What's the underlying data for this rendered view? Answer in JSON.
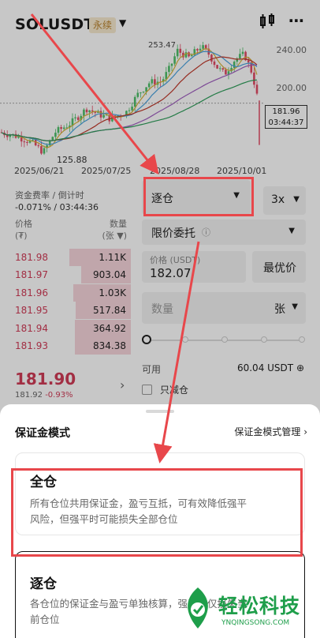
{
  "header": {
    "symbol": "SOLUSDT",
    "contract_tag": "永续",
    "caret_icon": "caret-down-icon",
    "chart_icon": "candlestick-icon",
    "more_icon": "more-icon"
  },
  "chart": {
    "y_ticks": [
      "240.00",
      "200.00"
    ],
    "x_ticks": [
      "2025/06/21",
      "2025/07/25",
      "2025/08/28",
      "2025/10/01"
    ],
    "low_label": "125.88",
    "high_label": "253.47",
    "current_price": "181.96",
    "countdown": "03:44:37",
    "colors": {
      "up": "#4fbf6a",
      "down": "#e24b64",
      "ma_red": "#c0392b",
      "ma_green": "#2e9e5a",
      "ma_purple": "#a05fc0",
      "ma_blue": "#4aa3df",
      "ma_yellow": "#d8b23a"
    }
  },
  "funding": {
    "label": "资金费率 / 倒计时",
    "value": "-0.071% / 03:44:36"
  },
  "orderbook": {
    "price_header": "价格",
    "price_unit": "(₮)",
    "qty_header": "数量",
    "qty_unit": "(张 ▼)",
    "asks": [
      {
        "price": "181.98",
        "qty": "1.11K",
        "depth": 0.47
      },
      {
        "price": "181.97",
        "qty": "903.04",
        "depth": 0.38
      },
      {
        "price": "181.96",
        "qty": "1.03K",
        "depth": 0.44
      },
      {
        "price": "181.95",
        "qty": "517.84",
        "depth": 0.42
      },
      {
        "price": "181.94",
        "qty": "364.92",
        "depth": 0.43
      },
      {
        "price": "181.93",
        "qty": "834.38",
        "depth": 0.43
      }
    ],
    "last_price": "181.90",
    "mark_price": "181.92",
    "change": "-0.93%"
  },
  "order_form": {
    "margin_mode": "逐仓",
    "leverage": "3x",
    "order_type": "限价委托",
    "price_label": "价格 (USDT)",
    "price_value": "182.07",
    "best_price_button": "最优价",
    "qty_placeholder": "数量",
    "qty_unit": "张",
    "slider_level": 0,
    "available_label": "可用",
    "available_value": "60.04 USDT",
    "reduce_only_label": "只减仓"
  },
  "sheet": {
    "title": "保证金模式",
    "manage_link": "保证金模式管理",
    "options": [
      {
        "title": "全仓",
        "desc_line1": "所有仓位共用保证金，盈亏互抵，可有效降低强平",
        "desc_line2": "风险，但强平时可能损失全部仓位"
      },
      {
        "title": "逐仓",
        "desc_line1": "各仓位的保证金与盈亏单独核算，强平时仅损失当",
        "desc_line2": "前仓位"
      }
    ]
  },
  "annotation_color": "#e8474b",
  "watermark": {
    "text": "轻松科技",
    "url": "YNQINGSONG.COM"
  }
}
